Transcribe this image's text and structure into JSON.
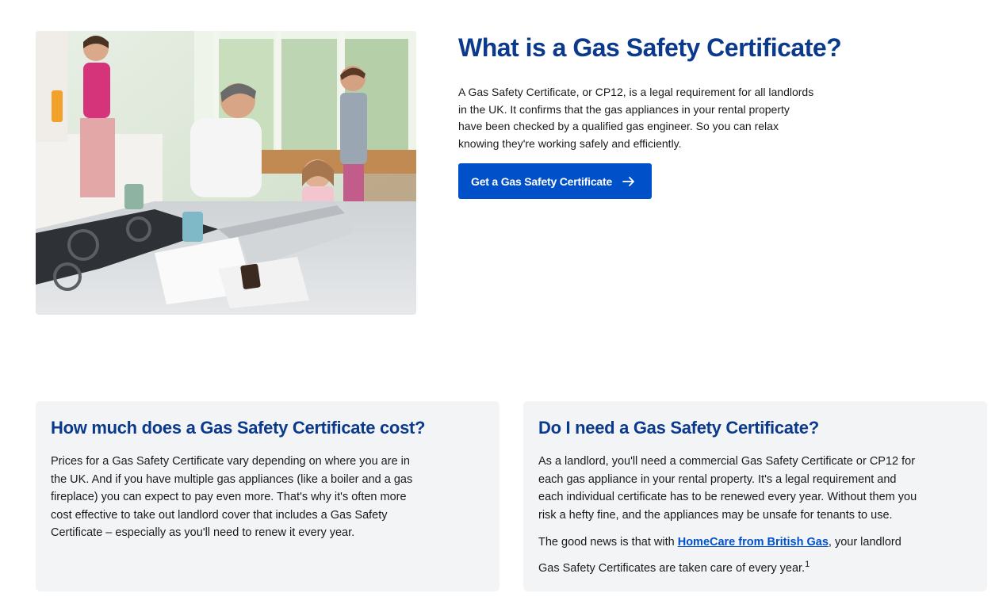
{
  "hero": {
    "title": "What is a Gas Safety Certificate?",
    "body": "A Gas Safety Certificate, or CP12, is a legal requirement for all landlords in the UK. It confirms that the gas appliances in your rental property have been checked by a qualified gas engineer. So you can relax knowing they're working safely and efficiently.",
    "cta_label": "Get a Gas Safety Certificate",
    "cta_icon": "arrow-right-icon",
    "image_alt": "family-in-kitchen-photo"
  },
  "cards": {
    "cost": {
      "title": "How much does a Gas Safety Certificate cost?",
      "body": "Prices for a Gas Safety Certificate vary depending on where you are in the UK. And if you have multiple gas appliances (like a boiler and a gas fireplace) you can expect to pay even more. That's why it's often more cost effective to take out landlord cover that includes a Gas Safety Certificate – especially as you'll need to renew it every year."
    },
    "need": {
      "title": "Do I need a Gas Safety Certificate?",
      "body": "As a landlord, you'll need a commercial Gas Safety Certificate or CP12 for each gas appliance in your rental property. It's a legal requirement and each individual certificate has to be renewed every year. Without them you risk a hefty fine, and the appliances may be unsafe for tenants to use.",
      "para2_before": "The good news is that with ",
      "link_text": "HomeCare from British Gas",
      "para2_after": ", your landlord Gas Safety Certificates are taken care of every year.",
      "footnote": "1"
    }
  },
  "colors": {
    "heading": "#0b3a8c",
    "button_bg": "#0051c9",
    "card_bg": "#f3f4f6",
    "link": "#0051c9"
  }
}
